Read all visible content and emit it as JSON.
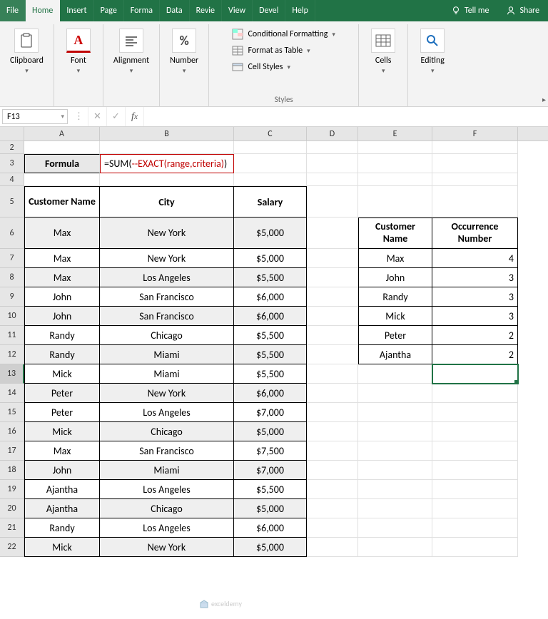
{
  "tabs": [
    "File",
    "Home",
    "Insert",
    "Page",
    "Forma",
    "Data",
    "Revie",
    "View",
    "Devel",
    "Help"
  ],
  "active_tab": "Home",
  "tell_me": "Tell me",
  "share": "Share",
  "ribbon": {
    "clipboard": "Clipboard",
    "font": "Font",
    "alignment": "Alignment",
    "number": "Number",
    "styles": "Styles",
    "cells": "Cells",
    "editing": "Editing",
    "cond_format": "Conditional Formatting",
    "format_table": "Format as Table",
    "cell_styles": "Cell Styles",
    "font_letter": "A",
    "number_sym": "%"
  },
  "name_box": "F13",
  "formula_bar": "",
  "columns": [
    "A",
    "B",
    "C",
    "D",
    "E",
    "F"
  ],
  "row3": {
    "label": "Formula",
    "formula_prefix": "=SUM(",
    "formula_mid": "--EXACT(range,criteria)",
    "formula_suffix": ")"
  },
  "headers": {
    "customer": "Customer Name",
    "city": "City",
    "salary": "Salary",
    "occurrence": "Occurrence Number"
  },
  "main_table": [
    {
      "name": "Max",
      "city": "New York",
      "salary": "$5,000",
      "shade": true,
      "tall": true
    },
    {
      "name": "Max",
      "city": "New York",
      "salary": "$5,000"
    },
    {
      "name": "Max",
      "city": "Los Angeles",
      "salary": "$5,500",
      "shade": true
    },
    {
      "name": "John",
      "city": "San Francisco",
      "salary": "$6,000"
    },
    {
      "name": "John",
      "city": "San Francisco",
      "salary": "$6,000",
      "shade": true
    },
    {
      "name": "Randy",
      "city": "Chicago",
      "salary": "$5,500"
    },
    {
      "name": "Randy",
      "city": "Miami",
      "salary": "$5,500",
      "shade": true
    },
    {
      "name": "Mick",
      "city": "Miami",
      "salary": "$5,500"
    },
    {
      "name": "Peter",
      "city": "New York",
      "salary": "$6,000",
      "shade": true
    },
    {
      "name": "Peter",
      "city": "Los Angeles",
      "salary": "$7,000"
    },
    {
      "name": "Mick",
      "city": "Chicago",
      "salary": "$5,000",
      "shade": true
    },
    {
      "name": "Max",
      "city": "San Francisco",
      "salary": "$7,500"
    },
    {
      "name": "John",
      "city": "Miami",
      "salary": "$7,000",
      "shade": true
    },
    {
      "name": "Ajantha",
      "city": "Los Angeles",
      "salary": "$5,500"
    },
    {
      "name": "Ajantha",
      "city": "Chicago",
      "salary": "$5,000",
      "shade": true
    },
    {
      "name": "Randy",
      "city": "Los Angeles",
      "salary": "$6,000"
    },
    {
      "name": "Mick",
      "city": "New York",
      "salary": "$5,000",
      "shade": true
    }
  ],
  "side_table": [
    {
      "name": "Max",
      "count": "4"
    },
    {
      "name": "John",
      "count": "3"
    },
    {
      "name": "Randy",
      "count": "3"
    },
    {
      "name": "Mick",
      "count": "3"
    },
    {
      "name": "Peter",
      "count": "2"
    },
    {
      "name": "Ajantha",
      "count": "2"
    }
  ],
  "watermark": "exceldemy"
}
